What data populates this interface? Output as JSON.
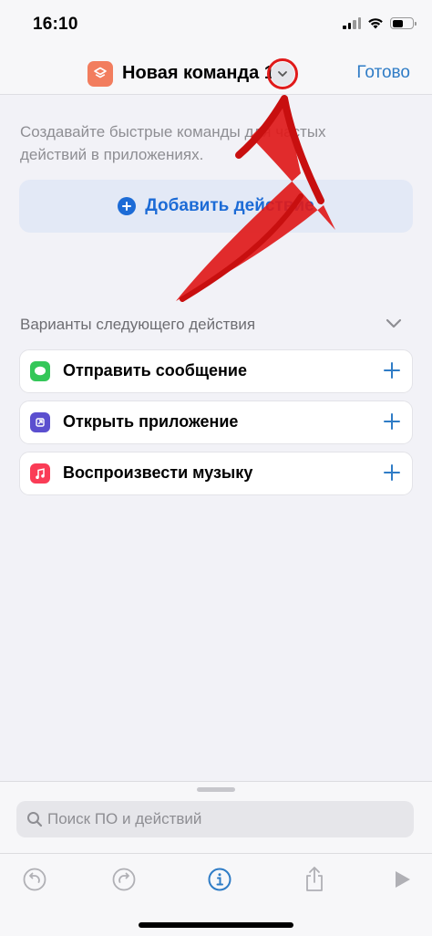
{
  "status_bar": {
    "time": "16:10"
  },
  "nav": {
    "title": "Новая команда 1",
    "done_label": "Готово",
    "app_icon": "shortcuts-layers-icon",
    "title_menu_icon": "chevron-down-icon"
  },
  "editor": {
    "hint": "Создавайте быстрые команды для частых действий в приложениях.",
    "add_action_label": "Добавить действие"
  },
  "suggestions": {
    "header": "Варианты следующего действия",
    "items": [
      {
        "label": "Отправить сообщение",
        "icon": "messages-icon",
        "color": "#34c759"
      },
      {
        "label": "Открыть приложение",
        "icon": "open-app-icon",
        "color": "#5b4fcf"
      },
      {
        "label": "Воспроизвести музыку",
        "icon": "music-icon",
        "color": "#fa3c56"
      }
    ]
  },
  "search": {
    "placeholder": "Поиск ПО и действий"
  },
  "toolbar": {
    "buttons": [
      "undo-icon",
      "redo-icon",
      "info-icon",
      "share-icon",
      "play-icon"
    ]
  },
  "colors": {
    "accent": "#2f7cc6",
    "annotation": "#e01a1a"
  }
}
